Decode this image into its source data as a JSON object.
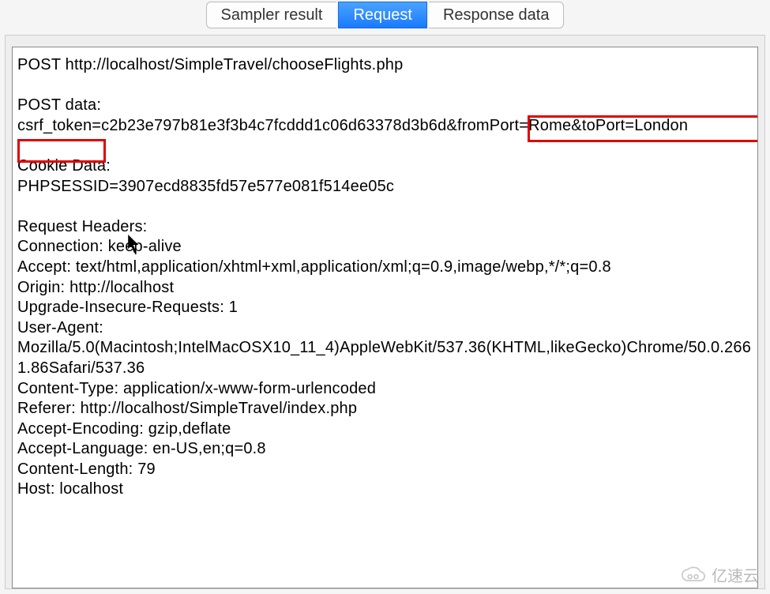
{
  "tabs": {
    "sampler": "Sampler result",
    "request": "Request",
    "response": "Response data"
  },
  "request": {
    "method_line": "POST http://localhost/SimpleTravel/chooseFlights.php",
    "post_data_label": "POST data:",
    "post_data_value": "csrf_token=c2b23e797b81e3f3b4c7fcddd1c06d63378d3b6d&fromPort=Rome&toPort=London",
    "cookie_label": "Cookie Data:",
    "cookie_value": "PHPSESSID=3907ecd8835fd57e577e081f514ee05c",
    "headers_label": "Request Headers:",
    "headers": {
      "connection": "Connection: keep-alive",
      "accept": "Accept: text/html,application/xhtml+xml,application/xml;q=0.9,image/webp,*/*;q=0.8",
      "origin": "Origin: http://localhost",
      "upgrade": "Upgrade-Insecure-Requests: 1",
      "ua_label": "User-Agent:",
      "ua_value": "Mozilla/5.0(Macintosh;IntelMacOSX10_11_4)AppleWebKit/537.36(KHTML,likeGecko)Chrome/50.0.2661.86Safari/537.36",
      "content_type": "Content-Type: application/x-www-form-urlencoded",
      "referer": "Referer: http://localhost/SimpleTravel/index.php",
      "accept_encoding": "Accept-Encoding: gzip,deflate",
      "accept_language": "Accept-Language: en-US,en;q=0.8",
      "content_length": "Content-Length: 79",
      "host": "Host: localhost"
    }
  },
  "watermark": "亿速云"
}
